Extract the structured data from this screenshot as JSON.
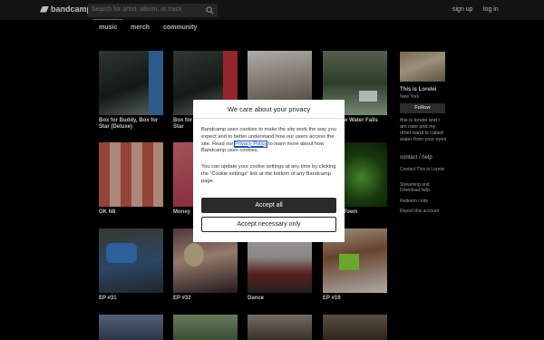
{
  "header": {
    "logo_text": "bandcamp",
    "search_placeholder": "Search for artist, album, or track",
    "signup": "sign up",
    "login": "log in"
  },
  "tabs": [
    {
      "label": "music",
      "active": true
    },
    {
      "label": "merch",
      "active": false
    },
    {
      "label": "community",
      "active": false
    }
  ],
  "releases": [
    {
      "title": "Box for Buddy, Box for Star (Deluxe)"
    },
    {
      "title": "Box for Buddy, Box for Star"
    },
    {
      "title": ""
    },
    {
      "title": "Ice Water Falls"
    },
    {
      "title": "OK N8"
    },
    {
      "title": "Money"
    },
    {
      "title": ""
    },
    {
      "title": "Town"
    },
    {
      "title": "EP #31"
    },
    {
      "title": "EP #32"
    },
    {
      "title": "Dance"
    },
    {
      "title": "EP #19"
    }
  ],
  "artist": {
    "name": "This is Lorelei",
    "location": "New York",
    "follow": "Follow",
    "bio": "this is lorelei and i am nate and my other band is called water from your eyes",
    "contact_heading": "contact / help",
    "links": [
      "Contact This is Lorelei",
      "Streaming and Download help",
      "Redeem code",
      "Report this account"
    ]
  },
  "cookie_modal": {
    "title": "We care about your privacy",
    "text_before_link": "Bandcamp uses cookies to make the site work the way you expect and to better understand how our users access the site. Read our ",
    "privacy_link": "Privacy Policy",
    "text_after_link": " to learn more about how Bandcamp uses cookies.",
    "settings_text": "You can update your cookie settings at any time by clicking the “Cookie settings” link at the bottom of any Bandcamp page.",
    "accept_all": "Accept all",
    "accept_necessary": "Accept necessary only"
  },
  "colors": {
    "topbar": "#1a1a1a",
    "page_bg": "#000000",
    "primary_button": "#2a2a2a",
    "link": "#1f4fb5"
  }
}
